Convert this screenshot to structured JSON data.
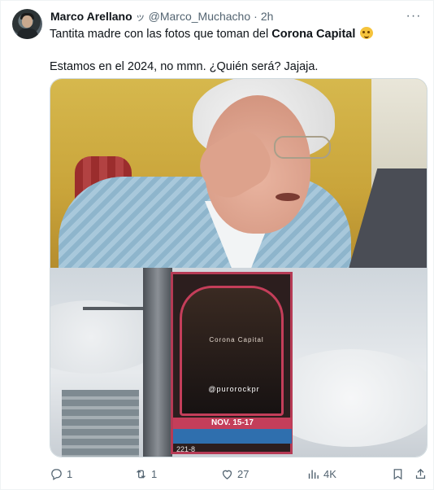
{
  "post": {
    "author_name": "Marco Arellano",
    "author_emoji": "ッ",
    "author_handle": "@Marco_Muchacho",
    "separator": "·",
    "time": "2h",
    "more_label": "···",
    "text_line1_pre": "Tantita madre con las fotos que toman del ",
    "text_line1_bold": "Corona Capital",
    "text_line2": "Estamos en el 2024, no mmn. ¿Quién será? Jajaja."
  },
  "media": {
    "billboard_brand": "Corona Capital",
    "billboard_handle": "@purorockpr",
    "billboard_date": "NOV. 15-17",
    "billboard_code": "221-8"
  },
  "actions": {
    "replies": "1",
    "reposts": "1",
    "likes": "27",
    "views": "4K"
  }
}
